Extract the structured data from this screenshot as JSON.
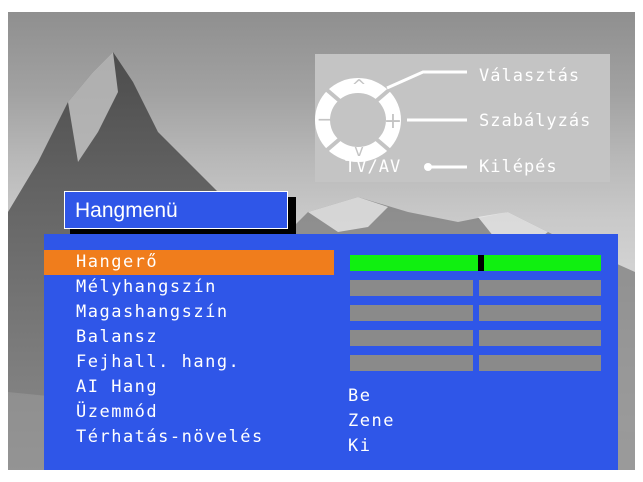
{
  "help": {
    "items": [
      {
        "label": "Választás"
      },
      {
        "label": "Szabályzás"
      },
      {
        "label": "Kilépés"
      }
    ],
    "remote_label": "TV/AV",
    "dpad_symbols": {
      "up": "^",
      "down": "v",
      "left": "−",
      "right": "+"
    }
  },
  "menu": {
    "title": "Hangmenü",
    "items": [
      {
        "label": "Hangerő",
        "selected": true,
        "level": 0.52
      },
      {
        "label": "Mélyhangszín",
        "selected": false,
        "level": 0.5
      },
      {
        "label": "Magashangszín",
        "selected": false,
        "level": 0.5
      },
      {
        "label": "Balansz",
        "selected": false,
        "level": 0.5
      },
      {
        "label": "Fejhall. hang.",
        "selected": false,
        "level": 0.5
      },
      {
        "label": "AI Hang",
        "value": "Be"
      },
      {
        "label": "Üzemmód",
        "value": "Zene"
      },
      {
        "label": "Térhatás-növelés",
        "value": "Ki"
      }
    ]
  },
  "colors": {
    "menu_background": "#2f56e8",
    "selection": "#f07d1c",
    "active_bar": "#10f010",
    "inactive_bar": "#8a8a8a"
  }
}
